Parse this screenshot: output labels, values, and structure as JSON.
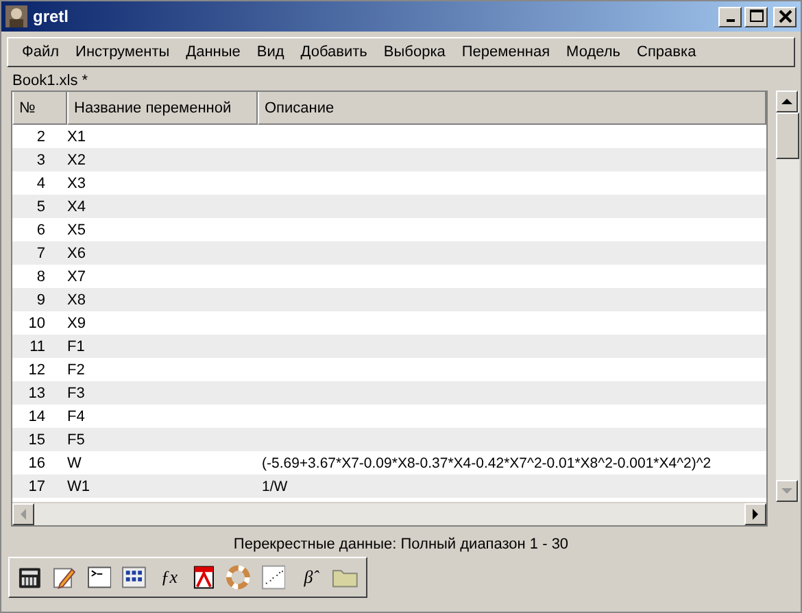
{
  "window": {
    "title": "gretl"
  },
  "menu": [
    "Файл",
    "Инструменты",
    "Данные",
    "Вид",
    "Добавить",
    "Выборка",
    "Переменная",
    "Модель",
    "Справка"
  ],
  "file_label": "Book1.xls *",
  "table": {
    "columns": [
      "№",
      "Название переменной",
      "Описание"
    ],
    "rows": [
      {
        "id": "2",
        "name": "X1",
        "description": ""
      },
      {
        "id": "3",
        "name": "X2",
        "description": ""
      },
      {
        "id": "4",
        "name": "X3",
        "description": ""
      },
      {
        "id": "5",
        "name": "X4",
        "description": ""
      },
      {
        "id": "6",
        "name": "X5",
        "description": ""
      },
      {
        "id": "7",
        "name": "X6",
        "description": ""
      },
      {
        "id": "8",
        "name": "X7",
        "description": ""
      },
      {
        "id": "9",
        "name": "X8",
        "description": ""
      },
      {
        "id": "10",
        "name": "X9",
        "description": ""
      },
      {
        "id": "11",
        "name": "F1",
        "description": ""
      },
      {
        "id": "12",
        "name": "F2",
        "description": ""
      },
      {
        "id": "13",
        "name": "F3",
        "description": ""
      },
      {
        "id": "14",
        "name": "F4",
        "description": ""
      },
      {
        "id": "15",
        "name": "F5",
        "description": ""
      },
      {
        "id": "16",
        "name": "W",
        "description": "(-5.69+3.67*X7-0.09*X8-0.37*X4-0.42*X7^2-0.01*X8^2-0.001*X4^2)^2"
      },
      {
        "id": "17",
        "name": "W1",
        "description": "1/W"
      }
    ]
  },
  "status_bar": "Перекрестные данные: Полный диапазон 1 - 30",
  "toolbar": [
    {
      "kind": "calculator"
    },
    {
      "kind": "notepad"
    },
    {
      "kind": "console"
    },
    {
      "kind": "matrix"
    },
    {
      "kind": "text",
      "label": "ƒx"
    },
    {
      "kind": "pdf"
    },
    {
      "kind": "lifebuoy"
    },
    {
      "kind": "scatter"
    },
    {
      "kind": "text",
      "label": "β̂"
    },
    {
      "kind": "folder"
    }
  ]
}
